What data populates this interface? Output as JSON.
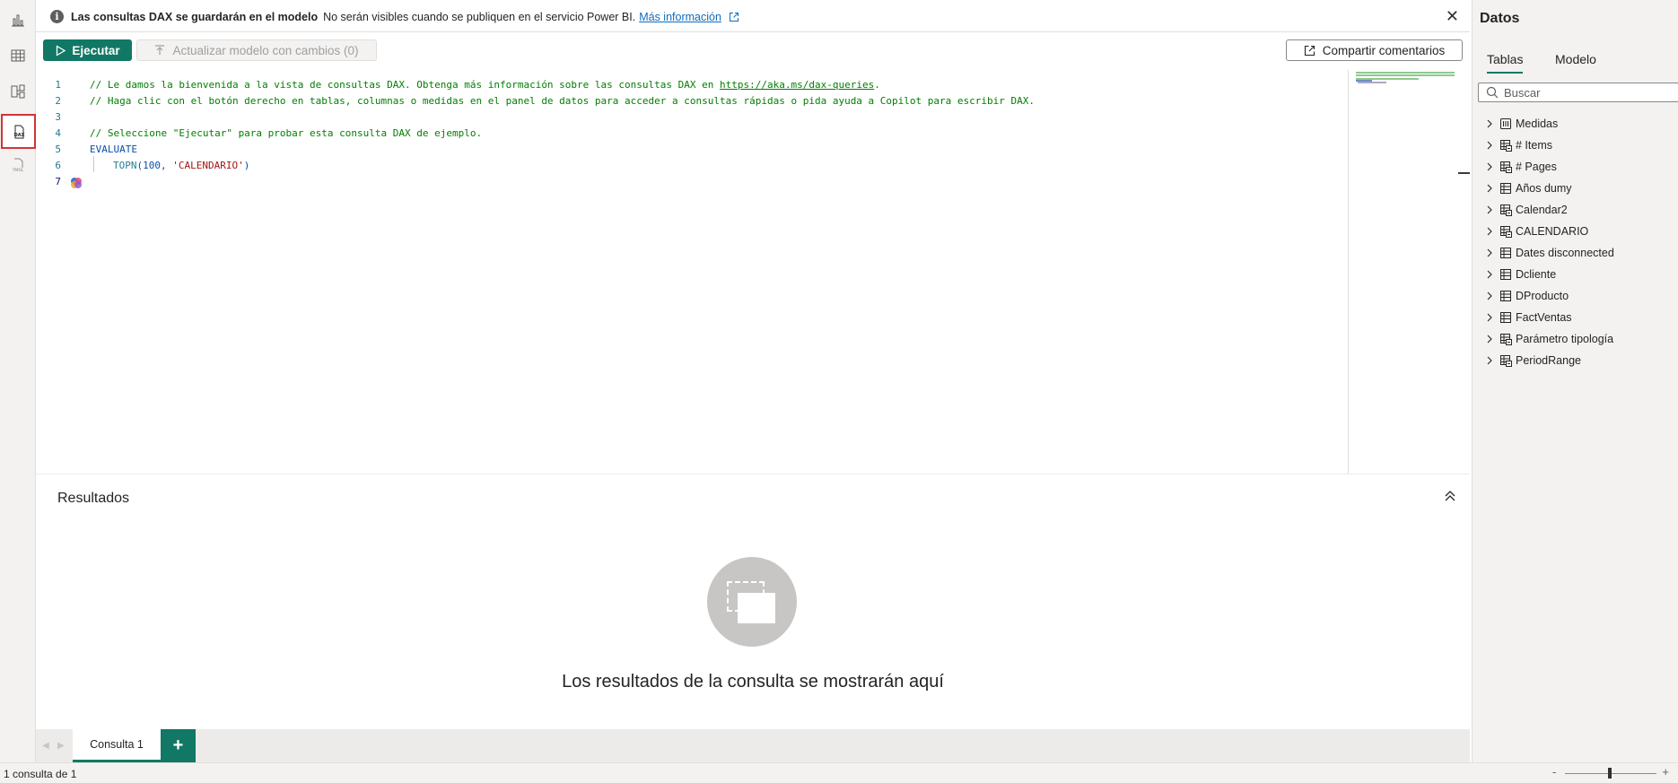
{
  "rail": {
    "items": [
      {
        "name": "report-view",
        "icon": "bar-chart-icon"
      },
      {
        "name": "table-view",
        "icon": "table-grid-icon"
      },
      {
        "name": "model-view",
        "icon": "model-diagram-icon"
      },
      {
        "name": "dax-query-view",
        "icon": "dax-icon",
        "label": "DAX",
        "active": true
      },
      {
        "name": "tmdl-view",
        "icon": "tmdl-icon",
        "label": "TMDL"
      }
    ]
  },
  "banner": {
    "bold_text": "Las consultas DAX se guardarán en el modelo",
    "text": "No serán visibles cuando se publiquen en el servicio Power BI.",
    "link": "Más información"
  },
  "toolbar": {
    "run_label": "Ejecutar",
    "update_label": "Actualizar modelo con cambios (0)",
    "share_label": "Compartir comentarios"
  },
  "editor": {
    "lines": [
      {
        "n": "1",
        "parts": [
          "// Le damos la bienvenida a la vista de consultas DAX. Obtenga más información sobre las consultas DAX en ",
          "https://aka.ms/dax-queries",
          "."
        ]
      },
      {
        "n": "2",
        "text": "// Haga clic con el botón derecho en tablas, columnas o medidas en el panel de datos para acceder a consultas rápidas o pida ayuda a Copilot para escribir DAX."
      },
      {
        "n": "3",
        "text": ""
      },
      {
        "n": "4",
        "text": "// Seleccione \"Ejecutar\" para probar esta consulta DAX de ejemplo."
      },
      {
        "n": "5",
        "text": "EVALUATE"
      },
      {
        "n": "6",
        "parts": [
          "TOPN",
          "(100, ",
          "'CALENDARIO'",
          ")"
        ]
      },
      {
        "n": "7",
        "text": ""
      }
    ]
  },
  "results": {
    "title": "Resultados",
    "empty_message": "Los resultados de la consulta se mostrarán aquí"
  },
  "query_tabs": {
    "tabs": [
      "Consulta 1"
    ],
    "add_label": "+"
  },
  "status": {
    "text": "1 consulta de 1",
    "zoom_minus": "-",
    "zoom_plus": "+"
  },
  "data_pane": {
    "title": "Datos",
    "tabs": [
      "Tablas",
      "Modelo"
    ],
    "search_placeholder": "Buscar",
    "tables": [
      {
        "name": "Medidas",
        "icon": "measure-table-icon"
      },
      {
        "name": "# Items",
        "icon": "calc-table-icon"
      },
      {
        "name": "# Pages",
        "icon": "calc-table-icon"
      },
      {
        "name": "Años dumy",
        "icon": "table-icon"
      },
      {
        "name": "Calendar2",
        "icon": "calc-table-icon"
      },
      {
        "name": "CALENDARIO",
        "icon": "calc-table-icon"
      },
      {
        "name": "Dates disconnected",
        "icon": "table-icon"
      },
      {
        "name": "Dcliente",
        "icon": "table-icon"
      },
      {
        "name": "DProducto",
        "icon": "table-icon"
      },
      {
        "name": "FactVentas",
        "icon": "table-icon"
      },
      {
        "name": "Parámetro tipología",
        "icon": "calc-table-icon"
      },
      {
        "name": "PeriodRange",
        "icon": "calc-table-icon"
      }
    ]
  },
  "colors": {
    "accent": "#117865",
    "highlight_border": "#d13438",
    "comment": "#008000",
    "keyword": "#0000ff"
  }
}
